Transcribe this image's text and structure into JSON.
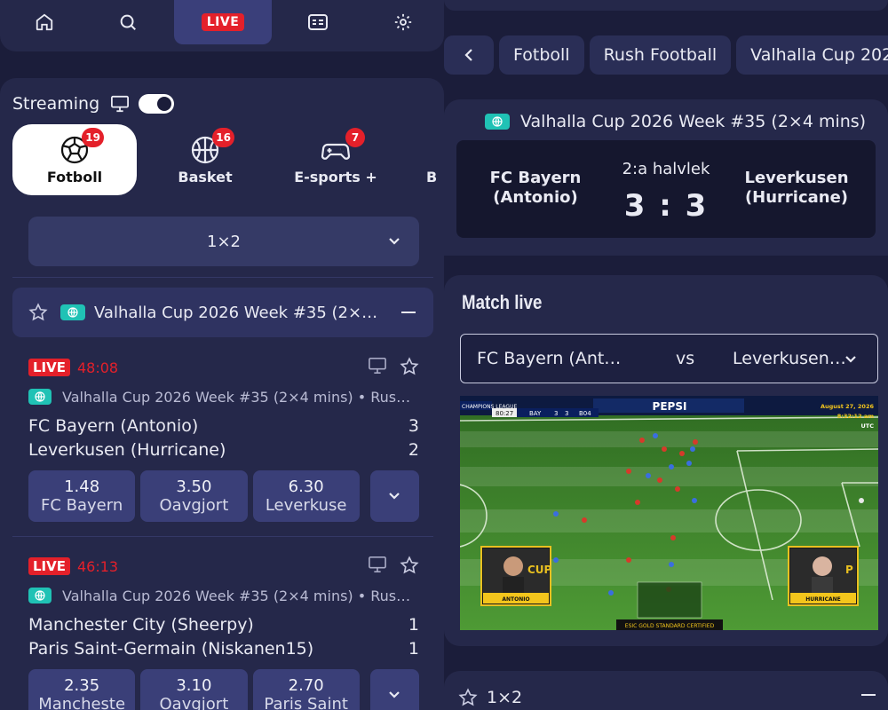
{
  "nav": {
    "live_label": "LIVE"
  },
  "streaming": {
    "label": "Streaming",
    "enabled": true
  },
  "sports": [
    {
      "label": "Fotboll",
      "count": "19",
      "active": true
    },
    {
      "label": "Basket",
      "count": "16",
      "active": false
    },
    {
      "label": "E-sports +",
      "count": "7",
      "active": false
    },
    {
      "label": "B",
      "count": "",
      "active": false
    }
  ],
  "market": {
    "selected": "1×2"
  },
  "league_group": {
    "title": "Valhalla Cup 2026 Week #35 (2×…"
  },
  "matches": [
    {
      "live": "LIVE",
      "clock": "48:08",
      "league": "Valhalla Cup 2026 Week #35 (2×4 mins) • Rus…",
      "home": "FC Bayern (Antonio)",
      "home_score": "3",
      "away": "Leverkusen (Hurricane)",
      "away_score": "2",
      "odds": [
        {
          "value": "1.48",
          "name": "FC Bayern"
        },
        {
          "value": "3.50",
          "name": "Oavgjort"
        },
        {
          "value": "6.30",
          "name": "Leverkuse"
        }
      ]
    },
    {
      "live": "LIVE",
      "clock": "46:13",
      "league": "Valhalla Cup 2026 Week #35 (2×4 mins) • Rus…",
      "home": "Manchester City (Sheerpy)",
      "home_score": "1",
      "away": "Paris Saint-Germain (Niskanen15)",
      "away_score": "1",
      "odds": [
        {
          "value": "2.35",
          "name": "Mancheste"
        },
        {
          "value": "3.10",
          "name": "Oavgjort"
        },
        {
          "value": "2.70",
          "name": "Paris Saint"
        }
      ]
    }
  ],
  "right": {
    "chips": [
      "Fotboll",
      "Rush Football",
      "Valhalla Cup 202"
    ],
    "score_league": "Valhalla Cup 2026 Week #35 (2×4 mins)",
    "scoreboard": {
      "home": "FC Bayern (Antonio)",
      "away": "Leverkusen (Hurricane)",
      "period": "2:a halvlek",
      "score": "3 : 3"
    },
    "match_live_title": "Match live",
    "match_select": {
      "home": "FC Bayern (Ant…",
      "vs": "vs",
      "away": "Leverkusen…"
    },
    "video": {
      "tournament": "CHAMPIONS LEAGUE",
      "time": "80:27",
      "home_code": "BAY",
      "home_score": "3",
      "away_score": "3",
      "away_code": "B04",
      "sponsor": "PEPSI",
      "date": "August 27, 2026",
      "clock": "8:32:12 am",
      "tz": "UTC",
      "player_left": "ANTONIO",
      "player_right": "HURRICANE",
      "cam_left_text": "CUP",
      "cam_right_text": "P",
      "footer": "ESIC GOLD STANDARD CERTIFIED"
    },
    "bottom_market": "1×2"
  },
  "colors": {
    "live_red": "#e4202a",
    "accent_teal": "#20c2b5",
    "panel": "#25284a",
    "background": "#1b1d3a"
  }
}
